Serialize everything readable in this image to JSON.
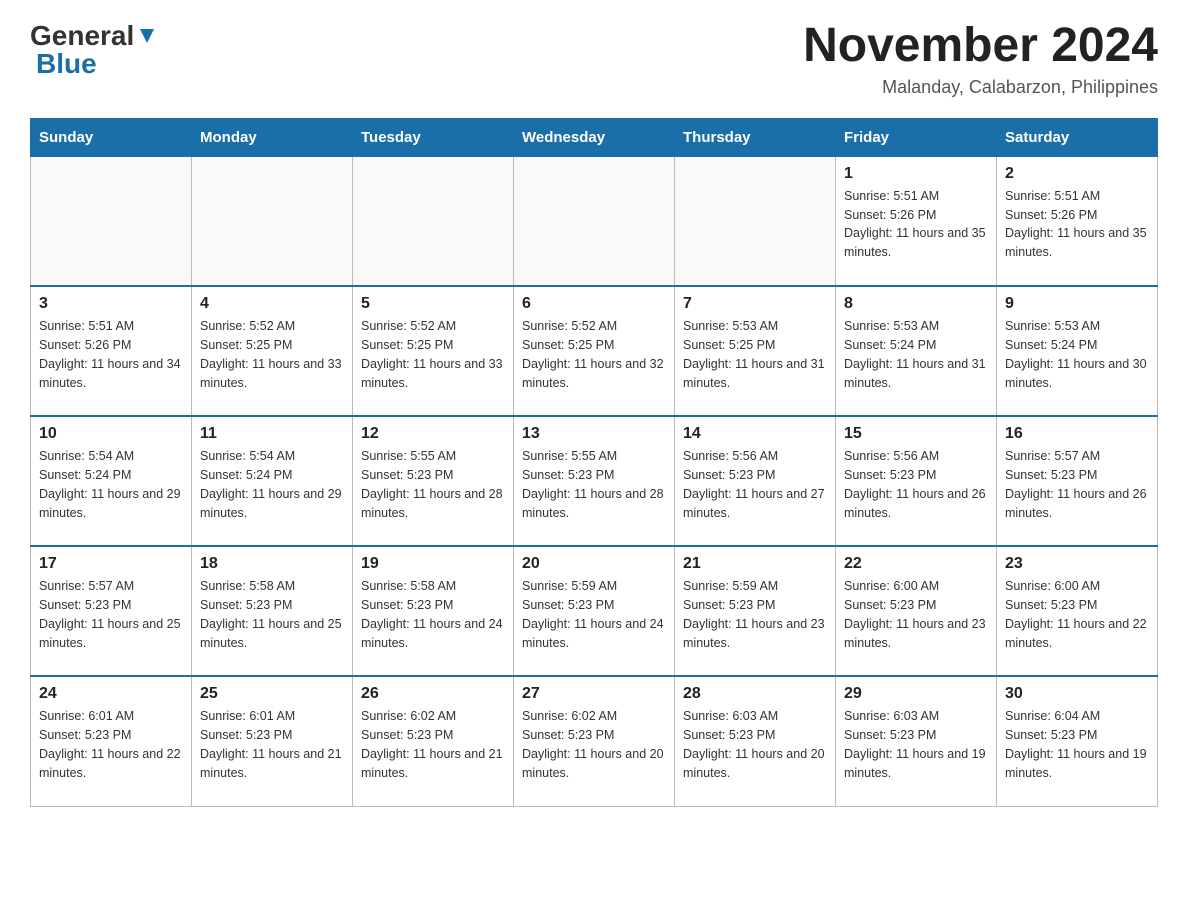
{
  "header": {
    "logo_general": "General",
    "logo_blue": "Blue",
    "month_title": "November 2024",
    "location": "Malanday, Calabarzon, Philippines"
  },
  "days_of_week": [
    "Sunday",
    "Monday",
    "Tuesday",
    "Wednesday",
    "Thursday",
    "Friday",
    "Saturday"
  ],
  "weeks": [
    [
      {
        "day": "",
        "info": ""
      },
      {
        "day": "",
        "info": ""
      },
      {
        "day": "",
        "info": ""
      },
      {
        "day": "",
        "info": ""
      },
      {
        "day": "",
        "info": ""
      },
      {
        "day": "1",
        "info": "Sunrise: 5:51 AM\nSunset: 5:26 PM\nDaylight: 11 hours and 35 minutes."
      },
      {
        "day": "2",
        "info": "Sunrise: 5:51 AM\nSunset: 5:26 PM\nDaylight: 11 hours and 35 minutes."
      }
    ],
    [
      {
        "day": "3",
        "info": "Sunrise: 5:51 AM\nSunset: 5:26 PM\nDaylight: 11 hours and 34 minutes."
      },
      {
        "day": "4",
        "info": "Sunrise: 5:52 AM\nSunset: 5:25 PM\nDaylight: 11 hours and 33 minutes."
      },
      {
        "day": "5",
        "info": "Sunrise: 5:52 AM\nSunset: 5:25 PM\nDaylight: 11 hours and 33 minutes."
      },
      {
        "day": "6",
        "info": "Sunrise: 5:52 AM\nSunset: 5:25 PM\nDaylight: 11 hours and 32 minutes."
      },
      {
        "day": "7",
        "info": "Sunrise: 5:53 AM\nSunset: 5:25 PM\nDaylight: 11 hours and 31 minutes."
      },
      {
        "day": "8",
        "info": "Sunrise: 5:53 AM\nSunset: 5:24 PM\nDaylight: 11 hours and 31 minutes."
      },
      {
        "day": "9",
        "info": "Sunrise: 5:53 AM\nSunset: 5:24 PM\nDaylight: 11 hours and 30 minutes."
      }
    ],
    [
      {
        "day": "10",
        "info": "Sunrise: 5:54 AM\nSunset: 5:24 PM\nDaylight: 11 hours and 29 minutes."
      },
      {
        "day": "11",
        "info": "Sunrise: 5:54 AM\nSunset: 5:24 PM\nDaylight: 11 hours and 29 minutes."
      },
      {
        "day": "12",
        "info": "Sunrise: 5:55 AM\nSunset: 5:23 PM\nDaylight: 11 hours and 28 minutes."
      },
      {
        "day": "13",
        "info": "Sunrise: 5:55 AM\nSunset: 5:23 PM\nDaylight: 11 hours and 28 minutes."
      },
      {
        "day": "14",
        "info": "Sunrise: 5:56 AM\nSunset: 5:23 PM\nDaylight: 11 hours and 27 minutes."
      },
      {
        "day": "15",
        "info": "Sunrise: 5:56 AM\nSunset: 5:23 PM\nDaylight: 11 hours and 26 minutes."
      },
      {
        "day": "16",
        "info": "Sunrise: 5:57 AM\nSunset: 5:23 PM\nDaylight: 11 hours and 26 minutes."
      }
    ],
    [
      {
        "day": "17",
        "info": "Sunrise: 5:57 AM\nSunset: 5:23 PM\nDaylight: 11 hours and 25 minutes."
      },
      {
        "day": "18",
        "info": "Sunrise: 5:58 AM\nSunset: 5:23 PM\nDaylight: 11 hours and 25 minutes."
      },
      {
        "day": "19",
        "info": "Sunrise: 5:58 AM\nSunset: 5:23 PM\nDaylight: 11 hours and 24 minutes."
      },
      {
        "day": "20",
        "info": "Sunrise: 5:59 AM\nSunset: 5:23 PM\nDaylight: 11 hours and 24 minutes."
      },
      {
        "day": "21",
        "info": "Sunrise: 5:59 AM\nSunset: 5:23 PM\nDaylight: 11 hours and 23 minutes."
      },
      {
        "day": "22",
        "info": "Sunrise: 6:00 AM\nSunset: 5:23 PM\nDaylight: 11 hours and 23 minutes."
      },
      {
        "day": "23",
        "info": "Sunrise: 6:00 AM\nSunset: 5:23 PM\nDaylight: 11 hours and 22 minutes."
      }
    ],
    [
      {
        "day": "24",
        "info": "Sunrise: 6:01 AM\nSunset: 5:23 PM\nDaylight: 11 hours and 22 minutes."
      },
      {
        "day": "25",
        "info": "Sunrise: 6:01 AM\nSunset: 5:23 PM\nDaylight: 11 hours and 21 minutes."
      },
      {
        "day": "26",
        "info": "Sunrise: 6:02 AM\nSunset: 5:23 PM\nDaylight: 11 hours and 21 minutes."
      },
      {
        "day": "27",
        "info": "Sunrise: 6:02 AM\nSunset: 5:23 PM\nDaylight: 11 hours and 20 minutes."
      },
      {
        "day": "28",
        "info": "Sunrise: 6:03 AM\nSunset: 5:23 PM\nDaylight: 11 hours and 20 minutes."
      },
      {
        "day": "29",
        "info": "Sunrise: 6:03 AM\nSunset: 5:23 PM\nDaylight: 11 hours and 19 minutes."
      },
      {
        "day": "30",
        "info": "Sunrise: 6:04 AM\nSunset: 5:23 PM\nDaylight: 11 hours and 19 minutes."
      }
    ]
  ]
}
